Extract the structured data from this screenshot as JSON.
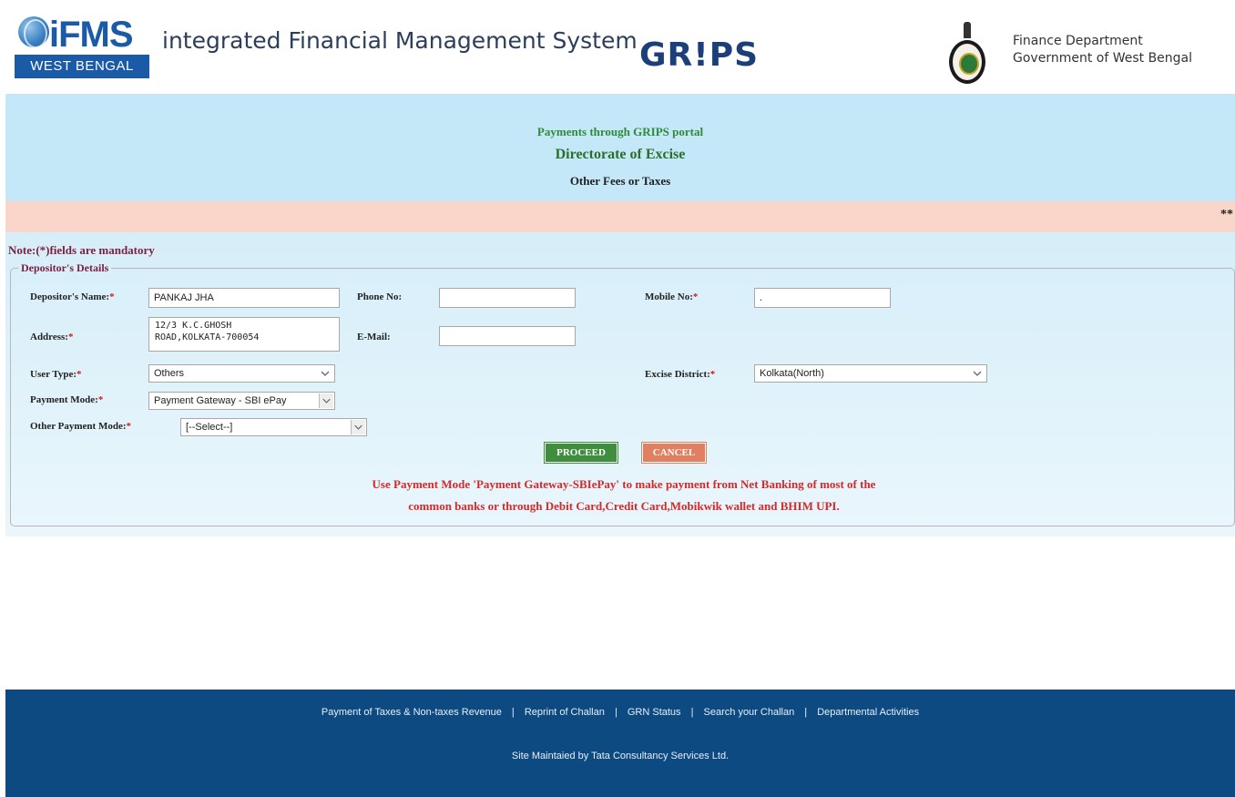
{
  "header": {
    "ifms_brand": "iFMS",
    "ifms_region": "WEST BENGAL",
    "system_title": "integrated Financial Management System",
    "grips_logo": "GR!PS",
    "dept_line1": "Finance Department",
    "dept_line2": "Government of West Bengal"
  },
  "banner": {
    "line1": "Payments through GRIPS portal",
    "line2": "Directorate of Excise",
    "line3": "Other Fees or Taxes",
    "marquee": "**"
  },
  "form": {
    "note": "Note:(*)fields are mandatory",
    "legend": "Depositor's Details",
    "depositor_name_label": "Depositor's Name:",
    "depositor_name_value": "PANKAJ JHA",
    "phone_label": "Phone No:",
    "phone_value": "",
    "mobile_label": "Mobile No:",
    "mobile_value": ".",
    "address_label": "Address:",
    "address_value": "12/3 K.C.GHOSH\nROAD,KOLKATA-700054",
    "email_label": "E-Mail:",
    "email_value": "",
    "user_type_label": "User Type:",
    "user_type_value": "Others",
    "excise_district_label": "Excise District:",
    "excise_district_value": "Kolkata(North)",
    "payment_mode_label": "Payment Mode:",
    "payment_mode_value": "Payment Gateway - SBI ePay",
    "other_payment_mode_label": "Other Payment Mode:",
    "other_payment_mode_value": "[--Select--]",
    "required_mark": "*",
    "proceed_label": "PROCEED",
    "cancel_label": "CANCEL",
    "info_line1": "Use Payment Mode 'Payment Gateway-SBIePay' to make payment from Net Banking of most of the",
    "info_line2": "common banks or through Debit Card,Credit Card,Mobikwik wallet and BHIM UPI."
  },
  "footer": {
    "links": [
      "Payment of Taxes & Non-taxes Revenue",
      "Reprint of Challan",
      "GRN Status",
      "Search your Challan",
      "Departmental Activities"
    ],
    "separator": "|",
    "credit": "Site Maintaied by Tata Consultancy Services Ltd."
  },
  "icons": {
    "dropdown": "chevron-down-icon",
    "emblem": "state-emblem-icon",
    "globe": "globe-icon"
  }
}
